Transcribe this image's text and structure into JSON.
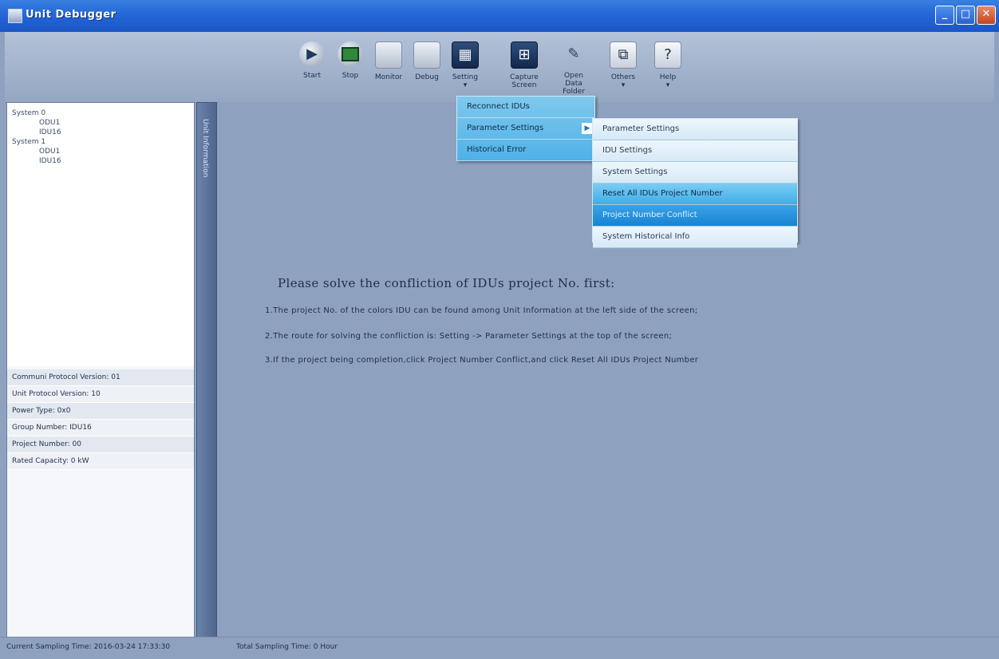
{
  "window": {
    "title": "Unit Debugger",
    "min": "_",
    "max": "□",
    "close": "✕"
  },
  "toolbar": [
    {
      "label": "Start",
      "icon": "play-icon"
    },
    {
      "label": "Stop",
      "icon": "stop-icon"
    },
    {
      "label": "Monitor",
      "icon": "monitor-icon"
    },
    {
      "label": "Debug",
      "icon": "debug-icon"
    },
    {
      "label": "Setting",
      "sub": "▾",
      "icon": "settings-icon"
    },
    {
      "label": "Capture",
      "sub": "Screen",
      "icon": "capture-icon"
    },
    {
      "label": "Open Data",
      "sub": "Folder",
      "icon": "pen-icon"
    },
    {
      "label": "Others",
      "sub": "▾",
      "icon": "others-icon"
    },
    {
      "label": "Help",
      "sub": "▾",
      "icon": "help-icon"
    }
  ],
  "tree": [
    "System 0",
    "ODU1",
    "IDU16",
    "System 1",
    "ODU1",
    "IDU16"
  ],
  "properties": [
    "Communi Protocol Version: 01",
    "Unit Protocol Version: 10",
    "Power Type: 0x0",
    "Group Number: IDU16",
    "Project Number: 00",
    "Rated Capacity: 0 kW"
  ],
  "sidebar_strip": "Unit Information",
  "menu_setting": {
    "items": [
      "Reconnect IDUs",
      "Parameter Settings",
      "Historical Error"
    ],
    "arrow": "▶"
  },
  "menu_parameter": {
    "items": [
      "Parameter Settings",
      "IDU Settings",
      "System Settings",
      "Reset All IDUs Project Number",
      "Project Number Conflict",
      "System Historical Info"
    ]
  },
  "message": {
    "title": "Please solve the confliction of IDUs project No. first:",
    "lines": [
      "1.The project No. of the colors IDU can be found among Unit Information at the left side of the screen;",
      "2.The route for solving the confliction is: Setting -> Parameter Settings at the top of the screen;",
      "3.If the project being completion,click Project Number Conflict,and click Reset All IDUs Project Number"
    ]
  },
  "status": {
    "current": "Current Sampling Time: 2016-03-24 17:33:30",
    "total": "Total Sampling Time: 0 Hour"
  }
}
